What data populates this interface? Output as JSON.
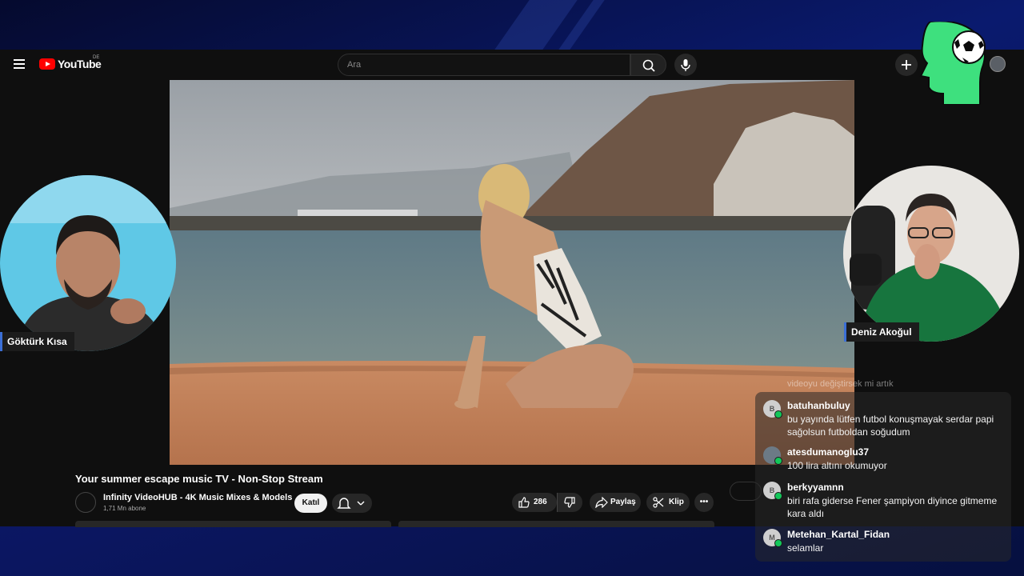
{
  "app": {
    "logo_text": "YouTube",
    "country_code": "DE"
  },
  "search": {
    "placeholder": "Ara"
  },
  "video": {
    "title": "Your summer escape music TV - Non-Stop Stream",
    "channel_name": "Infinity VideoHUB - 4K Music Mixes & Models",
    "subscribers": "1,71 Mn abone",
    "join_label": "Katıl",
    "like_count": "286",
    "share_label": "Paylaş",
    "clip_label": "Klip"
  },
  "streamers": {
    "left_name": "Göktürk Kısa",
    "right_name": "Deniz Akoğul"
  },
  "chat": {
    "faded_line": "videoyu değiştirsek mi artık",
    "messages": [
      {
        "initial": "B",
        "user": "batuhanbuluy",
        "text": "bu yayında lütfen futbol konuşmayak serdar papi sağolsun futboldan soğudum"
      },
      {
        "initial": "",
        "user": "atesdumanoglu37",
        "text": "100 lira altını okumuyor"
      },
      {
        "initial": "B",
        "user": "berkyyamnn",
        "text": "biri rafa giderse Fener şampiyon diyince gitmeme kara aldı"
      },
      {
        "initial": "M",
        "user": "Metehan_Kartal_Fidan",
        "text": "selamlar"
      }
    ]
  },
  "colors": {
    "accent": "#ff0000",
    "brain_green": "#3ee07e",
    "tag_blue": "#3b6fd6"
  }
}
